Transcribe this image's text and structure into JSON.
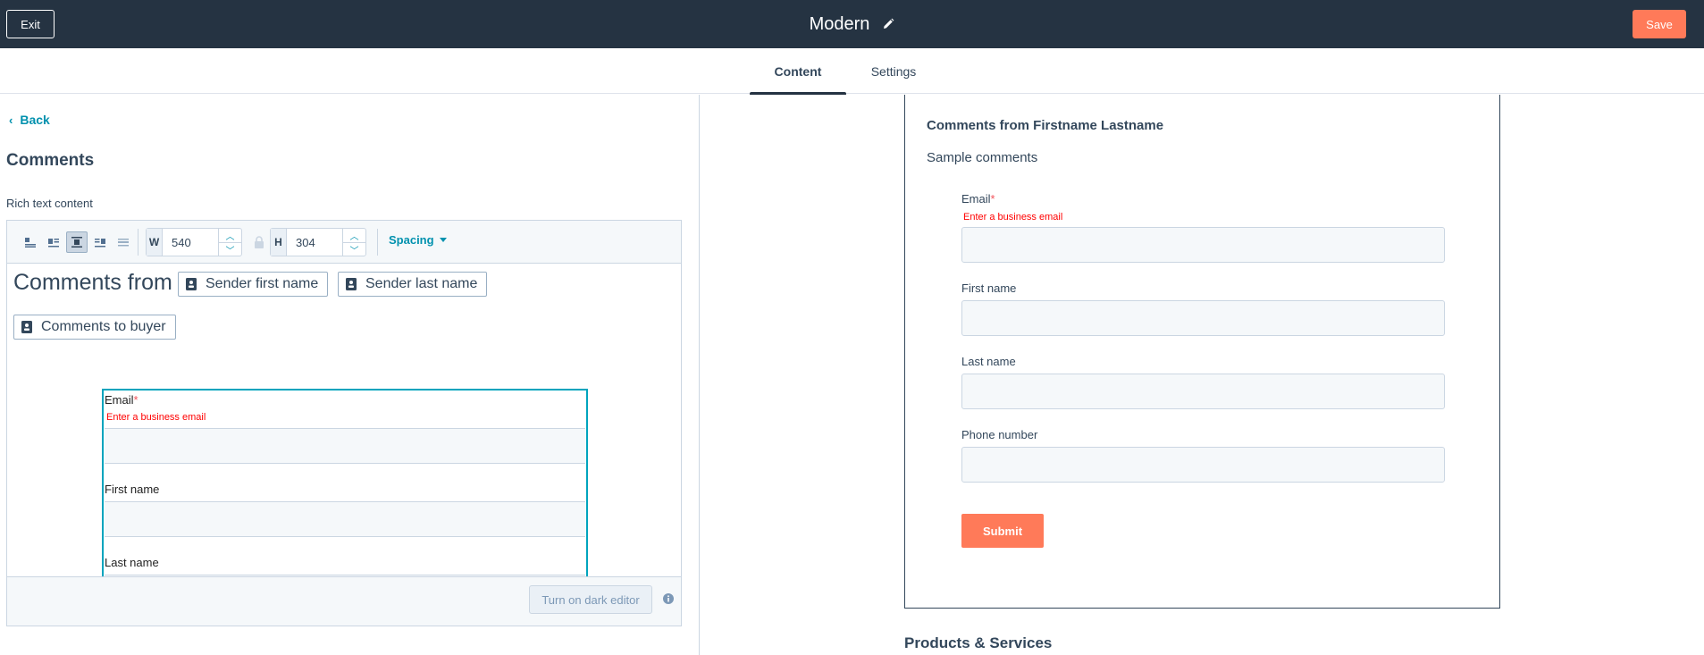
{
  "topbar": {
    "exit_label": "Exit",
    "title": "Modern",
    "save_label": "Save"
  },
  "tabs": [
    {
      "label": "Content",
      "active": true
    },
    {
      "label": "Settings",
      "active": false
    }
  ],
  "left": {
    "back_label": "Back",
    "section_title": "Comments",
    "field_label": "Rich text content",
    "toolbar": {
      "align_icons": [
        "align-left-icon",
        "float-left-icon",
        "align-center-icon",
        "float-right-icon",
        "full-width-icon"
      ],
      "width_prefix": "W",
      "width_value": "540",
      "height_prefix": "H",
      "height_value": "304",
      "spacing_label": "Spacing"
    },
    "body": {
      "heading_text": "Comments from",
      "tokens": [
        "Sender first name",
        "Sender last name",
        "Comments to buyer"
      ],
      "form": {
        "email_label": "Email",
        "required_mark": "*",
        "email_error": "Enter a business email",
        "first_name_label": "First name",
        "last_name_label": "Last name"
      }
    },
    "footer": {
      "dark_editor_label": "Turn on dark editor"
    }
  },
  "preview": {
    "title": "Comments from Firstname Lastname",
    "subtitle": "Sample comments",
    "email_label": "Email",
    "required_mark": "*",
    "email_error": "Enter a business email",
    "first_name_label": "First name",
    "last_name_label": "Last name",
    "phone_label": "Phone number",
    "submit_label": "Submit",
    "products_title": "Products & Services"
  },
  "colors": {
    "topbar_bg": "#253342",
    "accent_orange": "#ff7a59",
    "link_teal": "#0091ae",
    "selection_teal": "#00a4bd",
    "error_red": "#ff0000"
  }
}
